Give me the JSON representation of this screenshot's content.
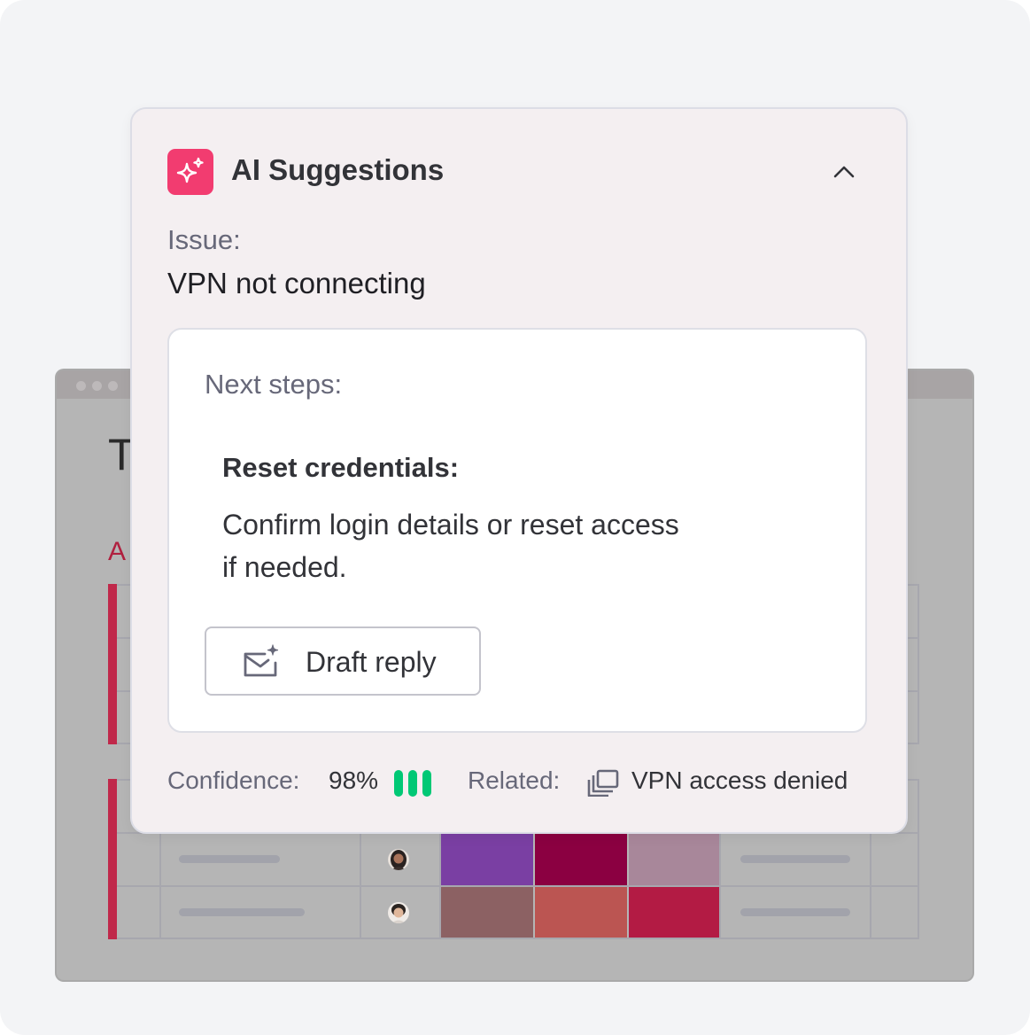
{
  "background_window": {
    "title_fragment": "T",
    "group_fragment": "A",
    "rows": [
      {
        "avatar": "avatar-person-1",
        "colors": [
          "#7a3fa3",
          "#8b0041",
          "#a8879a"
        ]
      },
      {
        "avatar": "avatar-person-2",
        "colors": [
          "#8c6163",
          "#bb5552",
          "#b31b44"
        ]
      }
    ],
    "accent_color": "#c0284a"
  },
  "card": {
    "icon": "sparkles-icon",
    "title": "AI Suggestions",
    "collapse_icon": "chevron-up-icon",
    "issue_label": "Issue:",
    "issue_value": "VPN not connecting",
    "next_steps_label": "Next steps:",
    "step_title": "Reset credentials:",
    "step_description": "Confirm login details or reset access if needed.",
    "draft_button": {
      "icon": "mail-sparkle-icon",
      "label": "Draft reply"
    },
    "footer": {
      "confidence_label": "Confidence:",
      "confidence_value": "98%",
      "confidence_level": 3,
      "confidence_color": "#00c875",
      "related_label": "Related:",
      "related_icon": "stacked-tickets-icon",
      "related_value": "VPN access denied"
    },
    "badge_color": "#f23c70"
  }
}
